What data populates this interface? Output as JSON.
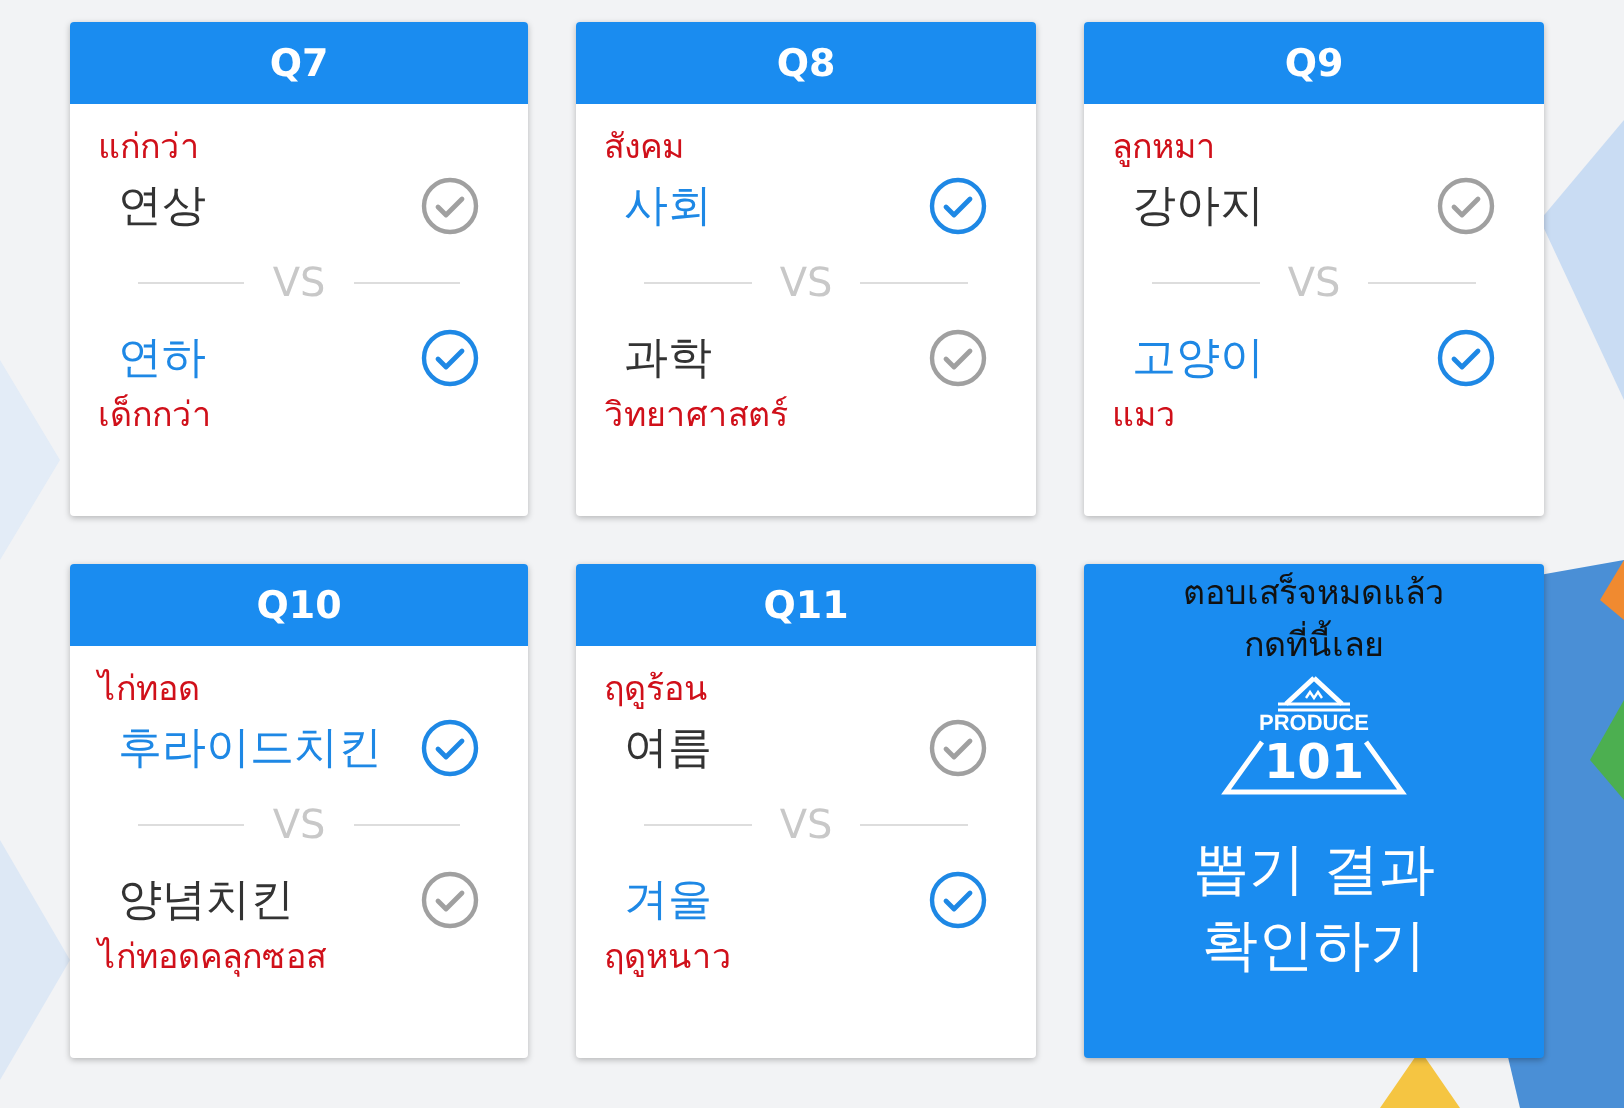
{
  "questions": [
    {
      "title": "Q7",
      "options": [
        {
          "text": "연상",
          "note": "แก่กว่า",
          "selected": false
        },
        {
          "text": "연하",
          "note": "เด็กกว่า",
          "selected": true
        }
      ],
      "divider": "VS"
    },
    {
      "title": "Q8",
      "options": [
        {
          "text": "사회",
          "note": "สังคม",
          "selected": true
        },
        {
          "text": "과학",
          "note": "วิทยาศาสตร์",
          "selected": false
        }
      ],
      "divider": "VS"
    },
    {
      "title": "Q9",
      "options": [
        {
          "text": "강아지",
          "note": "ลูกหมา",
          "selected": false
        },
        {
          "text": "고양이",
          "note": "แมว",
          "selected": true
        }
      ],
      "divider": "VS"
    },
    {
      "title": "Q10",
      "options": [
        {
          "text": "후라이드치킨",
          "note": "ไก่ทอด",
          "selected": true
        },
        {
          "text": "양념치킨",
          "note": "ไก่ทอดคลุกซอส",
          "selected": false
        }
      ],
      "divider": "VS"
    },
    {
      "title": "Q11",
      "options": [
        {
          "text": "여름",
          "note": "ฤดูร้อน",
          "selected": false
        },
        {
          "text": "겨울",
          "note": "ฤดูหนาว",
          "selected": true
        }
      ],
      "divider": "VS"
    }
  ],
  "result_card": {
    "note_lines": [
      "ตอบเสร็จหมดแล้ว",
      "กดที่นี้เลย"
    ],
    "logo_lines": [
      "PRODUCE",
      "101"
    ],
    "button_lines": [
      "뽑기 결과",
      "확인하기"
    ]
  }
}
